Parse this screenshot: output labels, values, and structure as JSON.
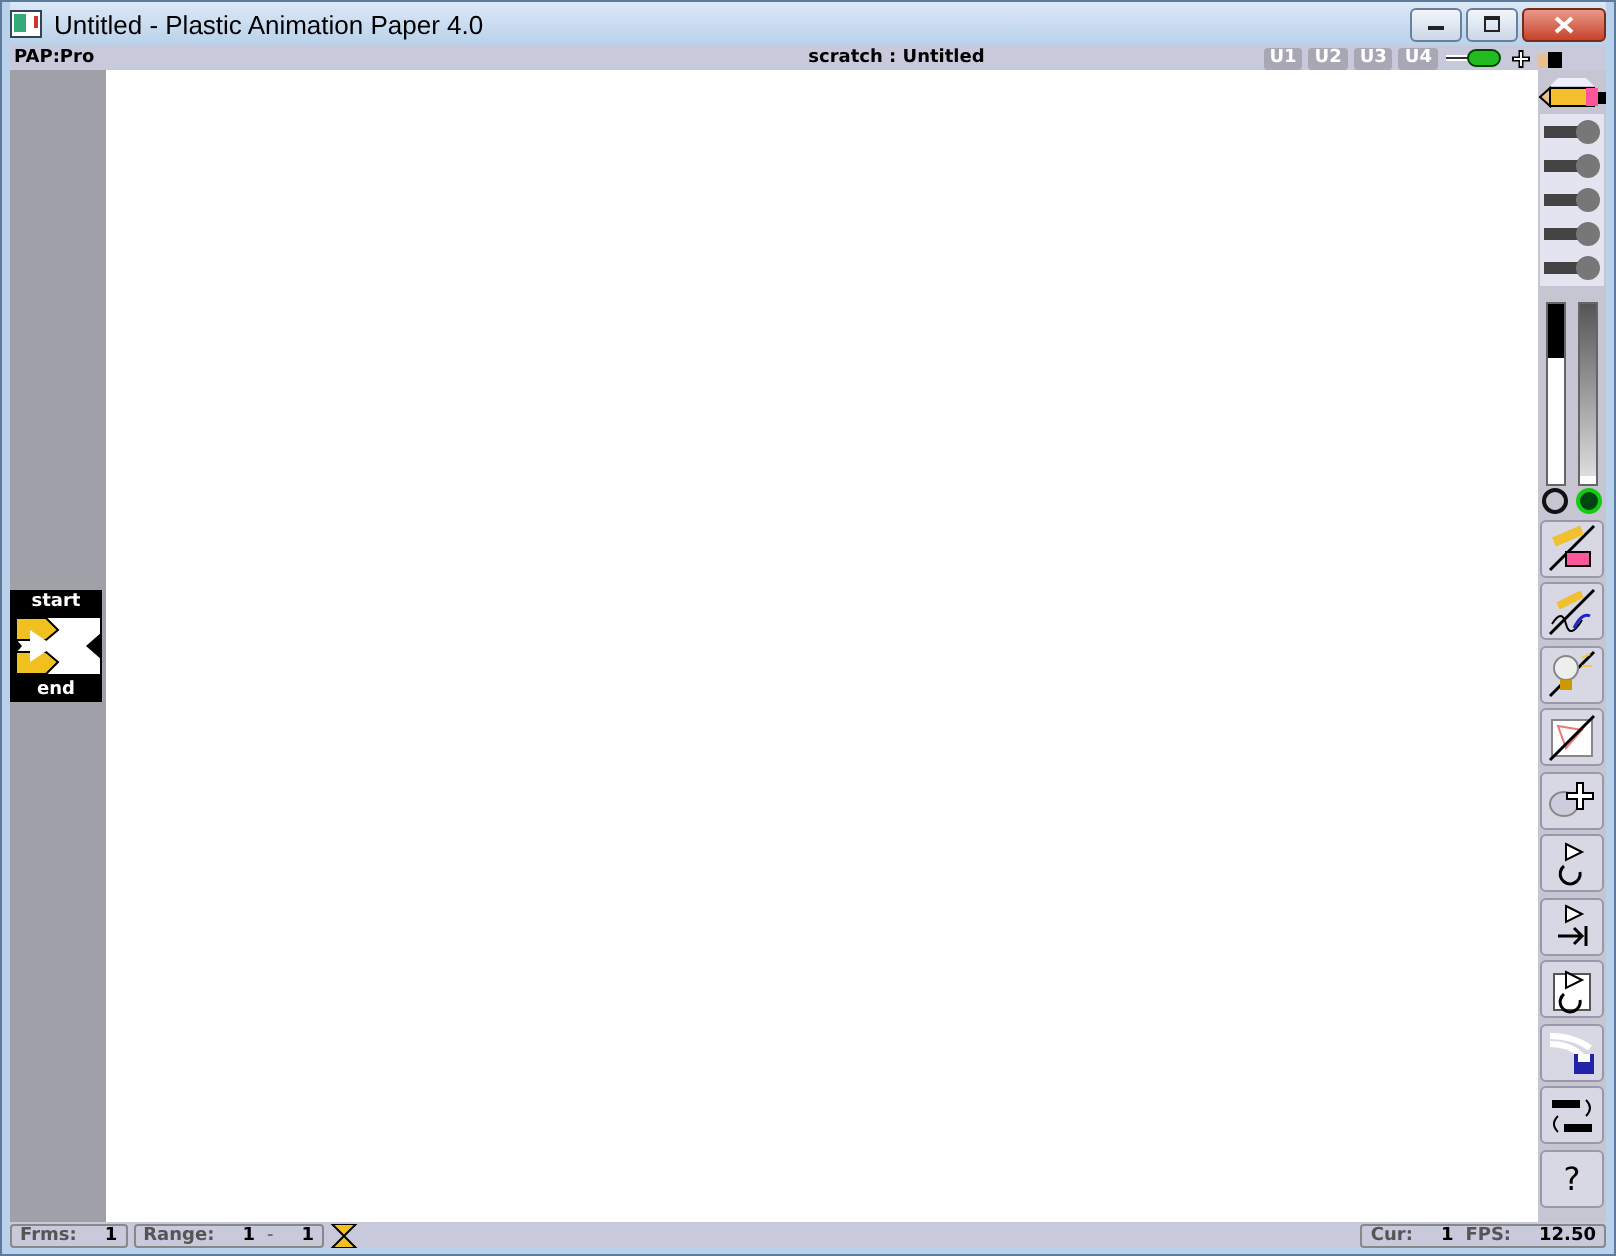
{
  "window": {
    "title": "Untitled - Plastic Animation Paper 4.0"
  },
  "header": {
    "mode": "PAP:Pro",
    "scene": "scratch : Untitled",
    "user_buttons": [
      {
        "label": "U1"
      },
      {
        "label": "U2"
      },
      {
        "label": "U3"
      },
      {
        "label": "U4"
      }
    ]
  },
  "frame_range_marker": {
    "start_label": "start",
    "end_label": "end"
  },
  "right_toolbar": {
    "sliders": [
      {
        "level": 0.3
      },
      {
        "level": 0.95
      }
    ],
    "radios": [
      {
        "selected": false
      },
      {
        "selected": true
      }
    ],
    "help_label": "?"
  },
  "status_bar": {
    "frames_label": "Frms:",
    "frames": "1",
    "range_label": "Range:",
    "range_from": "1",
    "range_sep": "-",
    "range_to": "1",
    "current_label": "Cur:",
    "current": "1",
    "fps_label": "FPS:",
    "fps": "12.50"
  }
}
